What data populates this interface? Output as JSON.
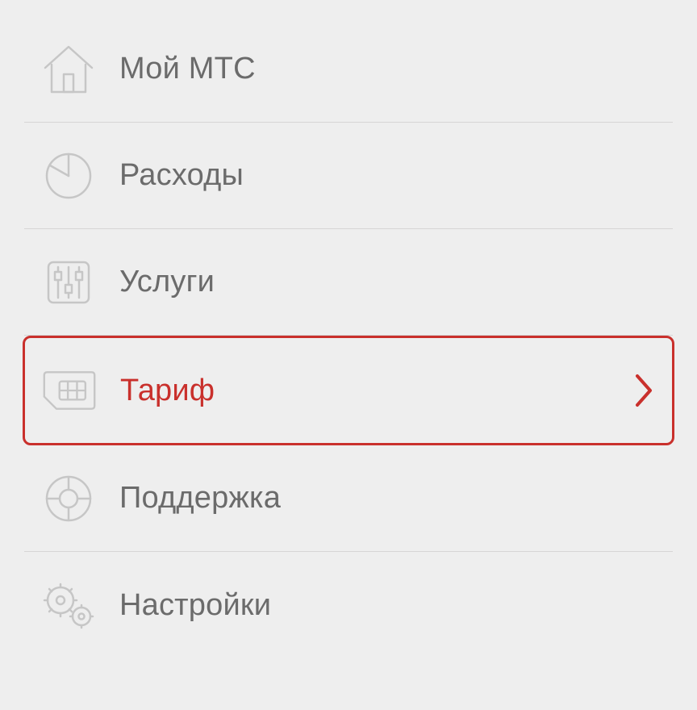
{
  "menu": {
    "items": [
      {
        "id": "home",
        "label": "Мой МТС",
        "iconName": "home-icon",
        "highlighted": false
      },
      {
        "id": "expenses",
        "label": "Расходы",
        "iconName": "pie-chart-icon",
        "highlighted": false
      },
      {
        "id": "services",
        "label": "Услуги",
        "iconName": "sliders-icon",
        "highlighted": false
      },
      {
        "id": "tariff",
        "label": "Тариф",
        "iconName": "sim-card-icon",
        "highlighted": true
      },
      {
        "id": "support",
        "label": "Поддержка",
        "iconName": "lifebuoy-icon",
        "highlighted": false
      },
      {
        "id": "settings",
        "label": "Настройки",
        "iconName": "gears-icon",
        "highlighted": false
      }
    ]
  },
  "colors": {
    "accent": "#c9302c",
    "iconStroke": "#b9b9b9",
    "text": "#6b6b6b",
    "divider": "#d6d5d5",
    "background": "#eeeeee"
  }
}
